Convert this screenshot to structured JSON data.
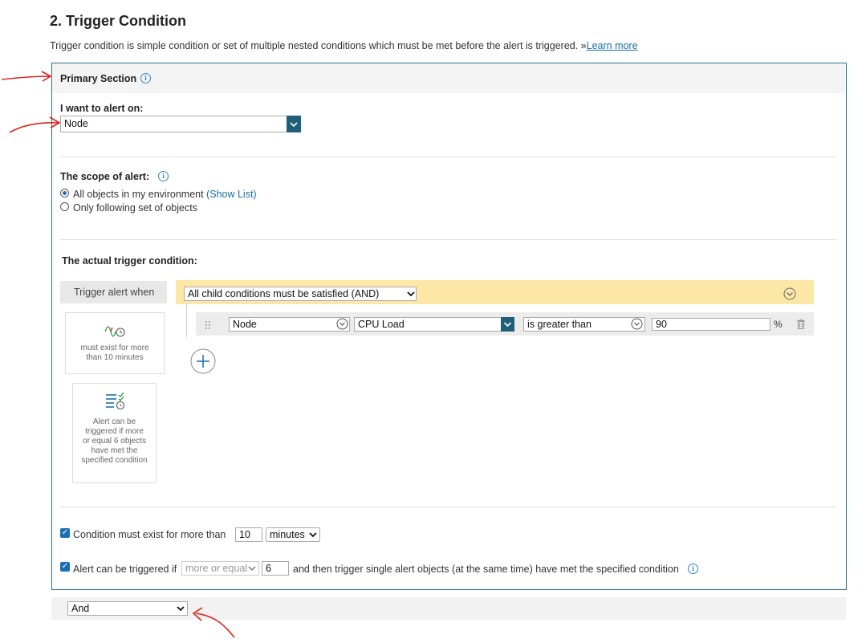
{
  "section": {
    "title": "2. Trigger Condition",
    "description": "Trigger condition is simple condition or set of multiple nested conditions which must be met before the alert is triggered. »",
    "learn_more": "Learn more"
  },
  "primary": {
    "title": "Primary Section",
    "alert_on_label": "I want to alert on:",
    "alert_on_value": "Node",
    "scope_label": "The scope of alert:",
    "scope_all": "All objects in my environment",
    "show_list": "(Show List)",
    "scope_following": "Only following set of objects",
    "actual_label": "The actual trigger condition:"
  },
  "trigger": {
    "when_label": "Trigger alert when",
    "group_value": "All child conditions must be satisfied (AND)",
    "row": {
      "object": "Node",
      "field": "CPU Load",
      "operator": "is greater than",
      "value": "90",
      "unit": "%"
    },
    "tile1_text": "must exist for more than 10 minutes",
    "tile2_text": "Alert can be triggered if more or equal 6 objects have met the specified condition"
  },
  "options": {
    "exist_label": "Condition must exist for more than",
    "exist_value": "10",
    "exist_unit": "minutes",
    "trigger_label": "Alert can be triggered if",
    "trigger_mode": "more or equal",
    "trigger_count": "6",
    "trigger_tail": "and then trigger single alert objects (at the same time) have met the specified condition"
  },
  "bottom": {
    "logic_value": "And"
  },
  "colors": {
    "accent": "#1f5f7a",
    "group_bar": "#fde7a6",
    "link": "#1a6fa0",
    "annotation": "#e0201a"
  }
}
